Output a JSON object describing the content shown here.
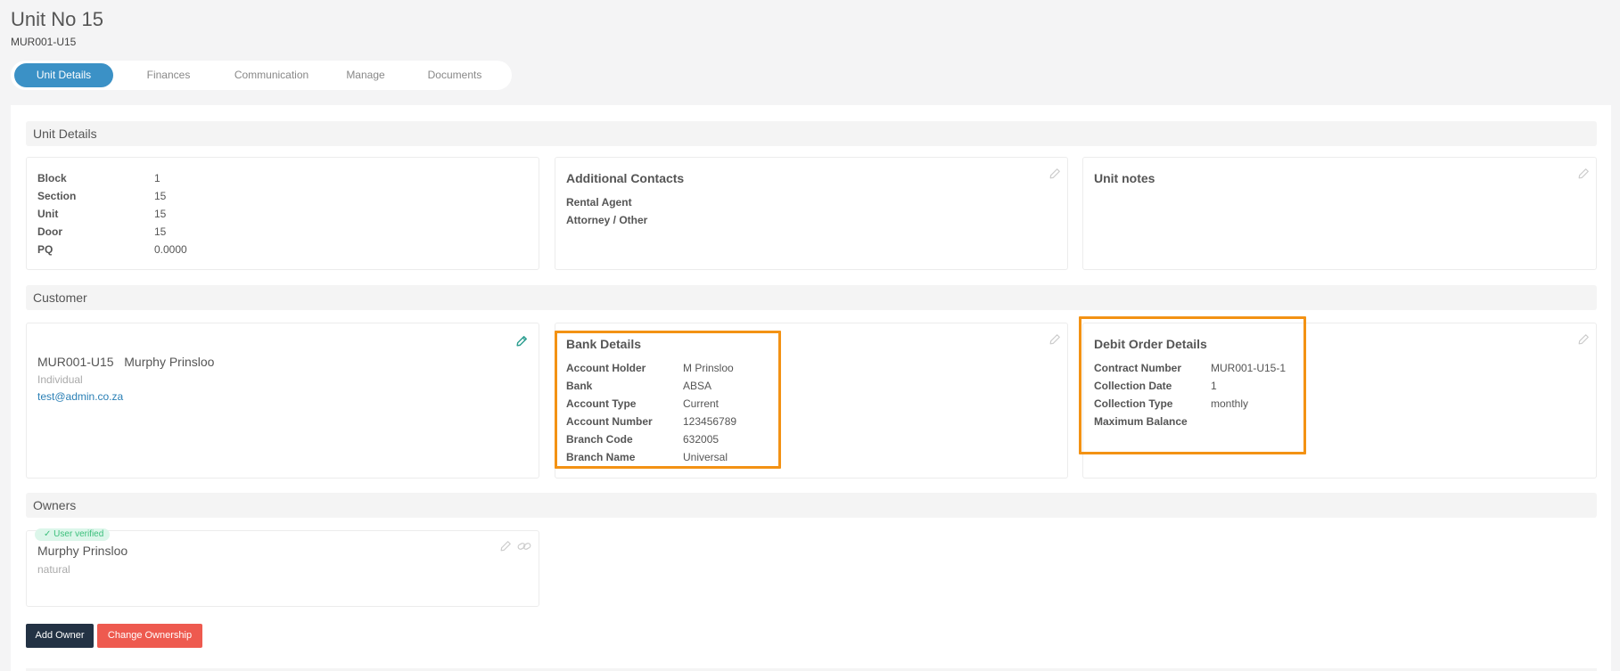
{
  "header": {
    "title": "Unit No 15",
    "subtitle": "MUR001-U15"
  },
  "tabs": [
    {
      "label": "Unit Details",
      "active": true
    },
    {
      "label": "Finances",
      "active": false
    },
    {
      "label": "Communication",
      "active": false
    },
    {
      "label": "Manage",
      "active": false
    },
    {
      "label": "Documents",
      "active": false
    }
  ],
  "unit_details": {
    "section_title": "Unit Details",
    "info": [
      {
        "label": "Block",
        "value": "1"
      },
      {
        "label": "Section",
        "value": "15"
      },
      {
        "label": "Unit",
        "value": "15"
      },
      {
        "label": "Door",
        "value": "15"
      },
      {
        "label": "PQ",
        "value": "0.0000"
      }
    ],
    "additional_contacts": {
      "title": "Additional Contacts",
      "items": [
        "Rental Agent",
        "Attorney / Other"
      ]
    },
    "unit_notes": {
      "title": "Unit notes"
    }
  },
  "customer": {
    "section_title": "Customer",
    "code": "MUR001-U15",
    "name": "Murphy Prinsloo",
    "type": "Individual",
    "email": "test@admin.co.za",
    "bank_details": {
      "title": "Bank Details",
      "rows": [
        {
          "label": "Account Holder",
          "value": "M Prinsloo"
        },
        {
          "label": "Bank",
          "value": "ABSA"
        },
        {
          "label": "Account Type",
          "value": "Current"
        },
        {
          "label": "Account Number",
          "value": "123456789"
        },
        {
          "label": "Branch Code",
          "value": "632005"
        },
        {
          "label": "Branch Name",
          "value": "Universal"
        }
      ]
    },
    "debit_order": {
      "title": "Debit Order Details",
      "rows": [
        {
          "label": "Contract Number",
          "value": "MUR001-U15-1"
        },
        {
          "label": "Collection Date",
          "value": "1"
        },
        {
          "label": "Collection Type",
          "value": "monthly"
        },
        {
          "label": "Maximum Balance",
          "value": ""
        }
      ]
    }
  },
  "owners": {
    "section_title": "Owners",
    "badge": "User verified",
    "name": "Murphy Prinsloo",
    "type": "natural",
    "add_owner_label": "Add Owner",
    "change_ownership_label": "Change Ownership"
  },
  "colors": {
    "accent": "#3b91c6",
    "highlight": "#f39214",
    "dark_button": "#233244",
    "danger_button": "#ee5a4f",
    "verified": "#3bbf7b",
    "edit_icon_active": "#2a9d8f"
  },
  "icons": [
    "pencil-icon",
    "link-icon",
    "check-icon"
  ]
}
